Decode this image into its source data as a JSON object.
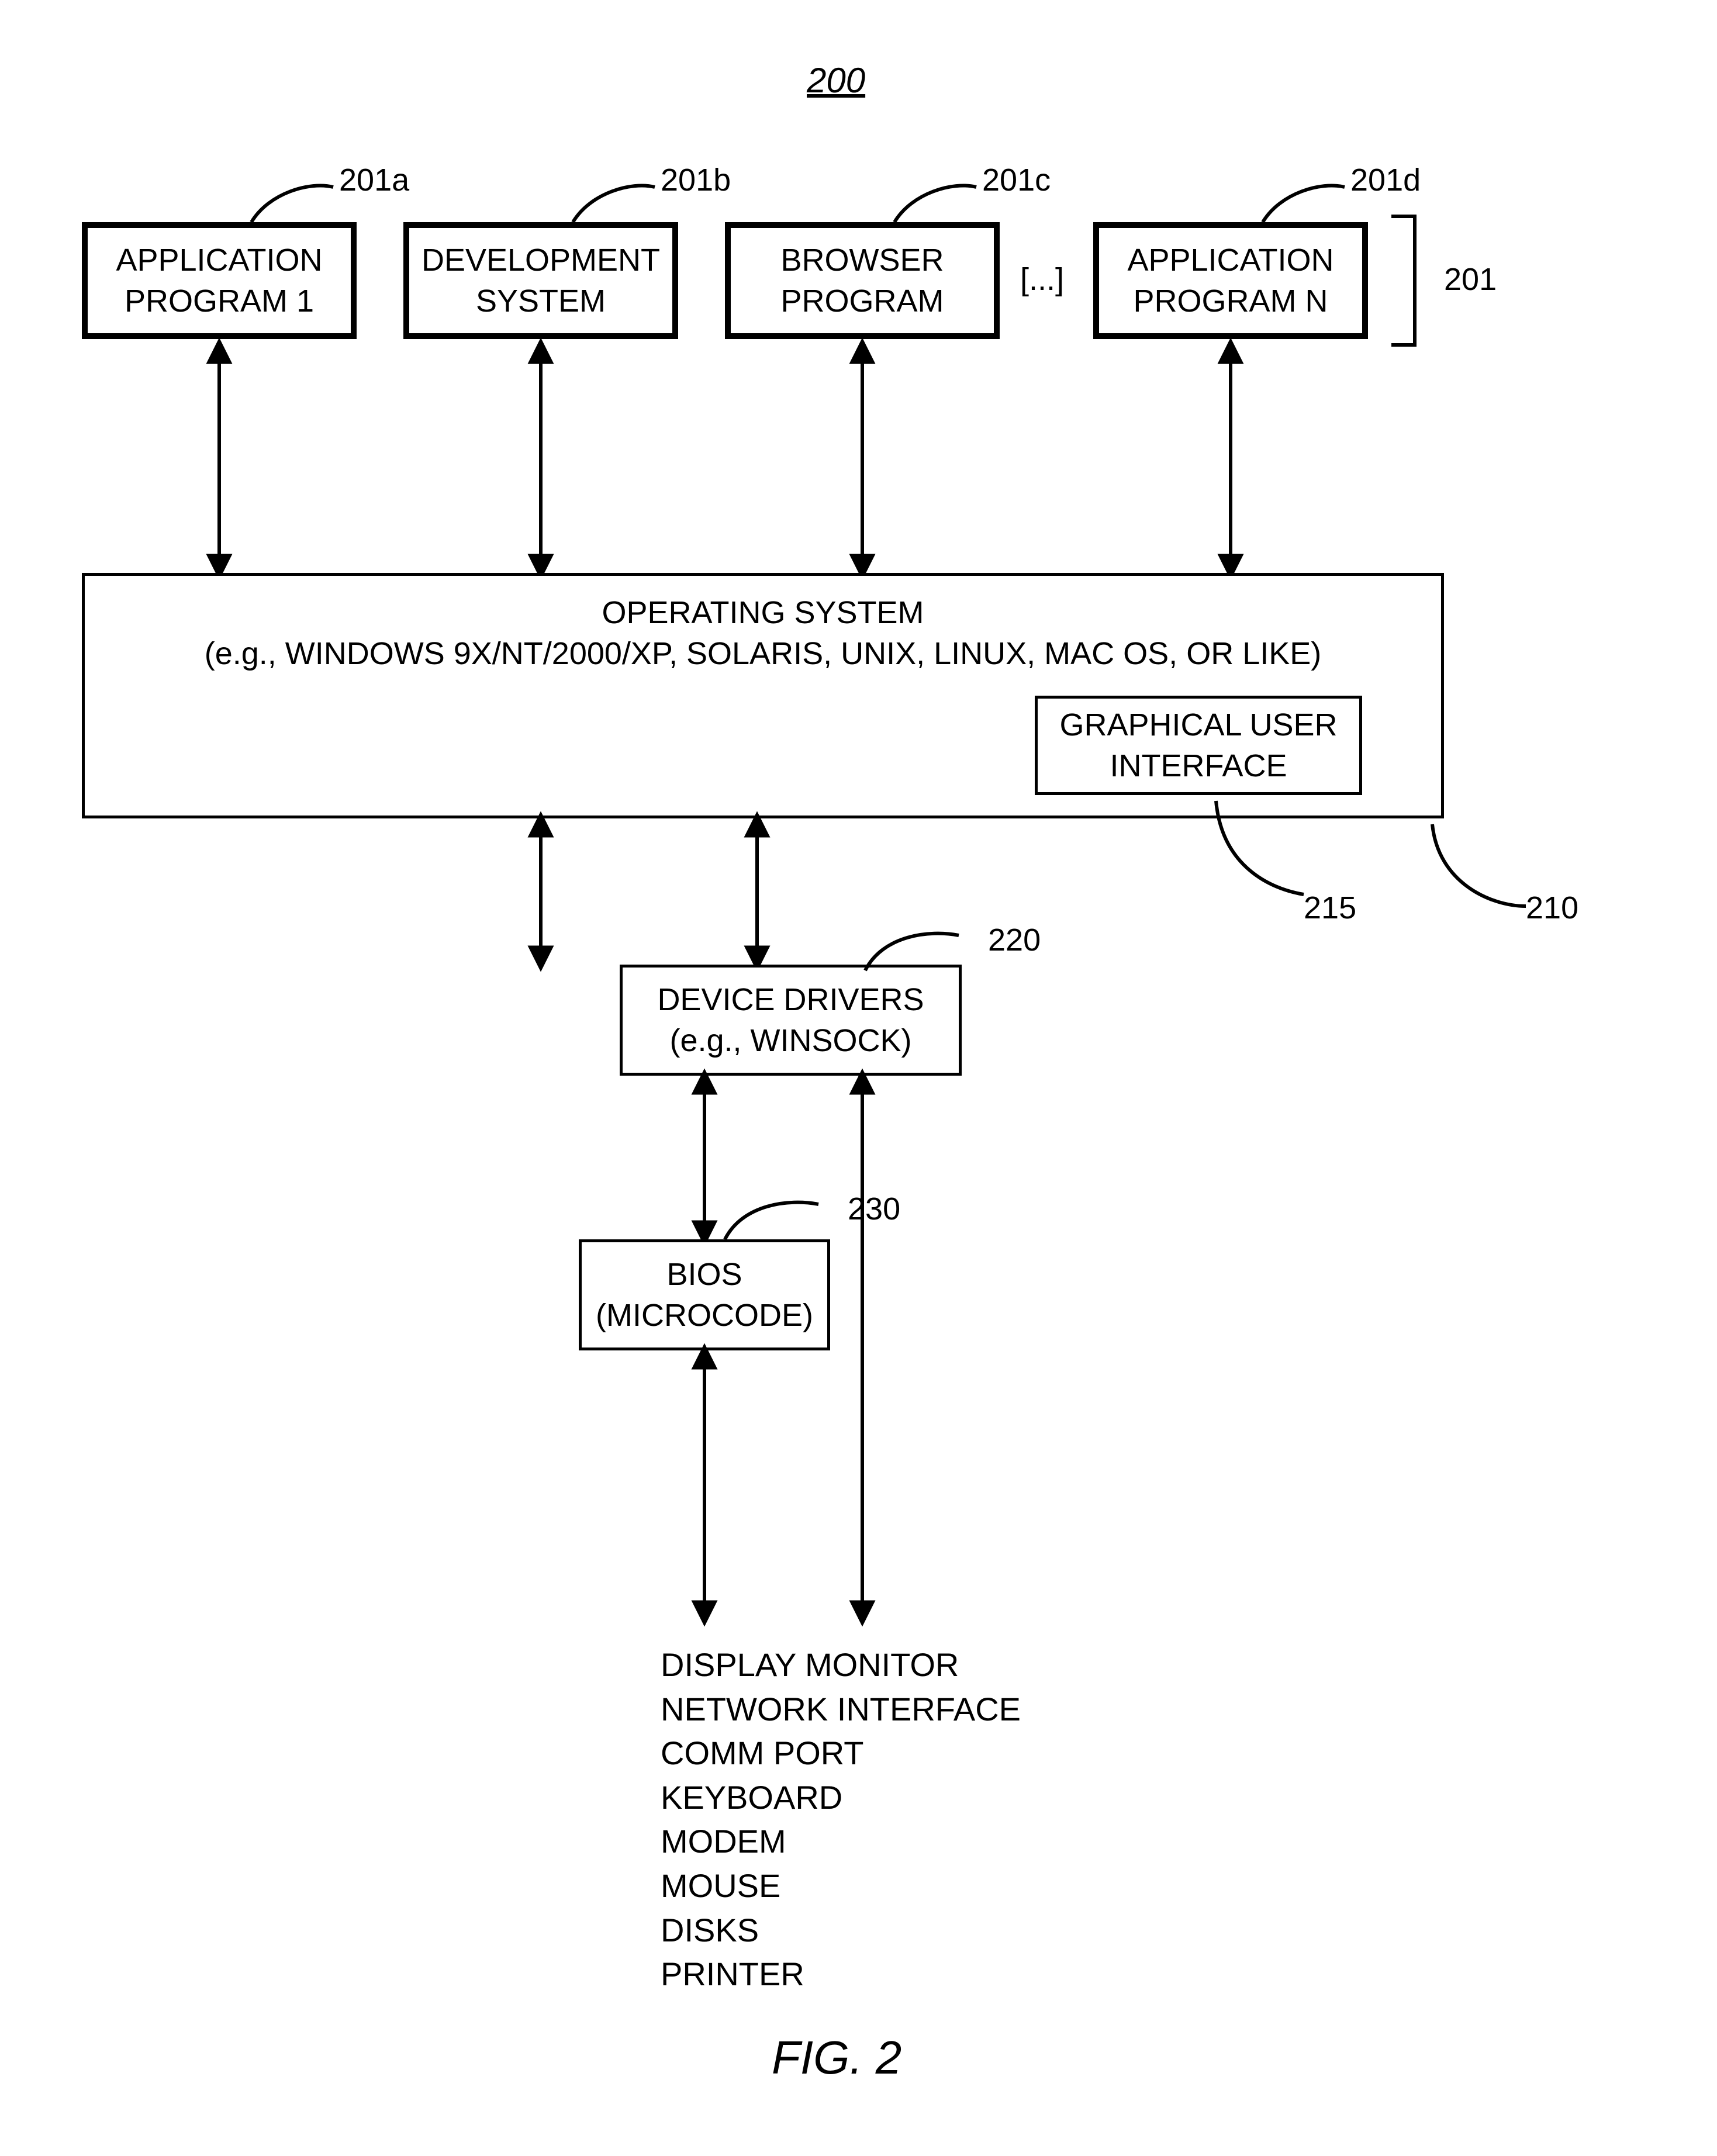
{
  "figure_number_top": "200",
  "figure_caption": "FIG. 2",
  "refs": {
    "r201a": "201a",
    "r201b": "201b",
    "r201c": "201c",
    "r201d": "201d",
    "r201": "201",
    "r210": "210",
    "r215": "215",
    "r220": "220",
    "r230": "230"
  },
  "apps": {
    "a": "APPLICATION\nPROGRAM 1",
    "b": "DEVELOPMENT\nSYSTEM",
    "c": "BROWSER\nPROGRAM",
    "d": "APPLICATION\nPROGRAM N",
    "ellipsis": "[...]"
  },
  "os": {
    "line1": "OPERATING SYSTEM",
    "line2": "(e.g., WINDOWS 9X/NT/2000/XP, SOLARIS, UNIX, LINUX, MAC OS, OR LIKE)",
    "gui": "GRAPHICAL\nUSER INTERFACE"
  },
  "drivers": "DEVICE DRIVERS\n(e.g., WINSOCK)",
  "bios": "BIOS\n(MICROCODE)",
  "devices": "DISPLAY MONITOR\nNETWORK INTERFACE\nCOMM PORT\nKEYBOARD\nMODEM\nMOUSE\nDISKS\nPRINTER"
}
